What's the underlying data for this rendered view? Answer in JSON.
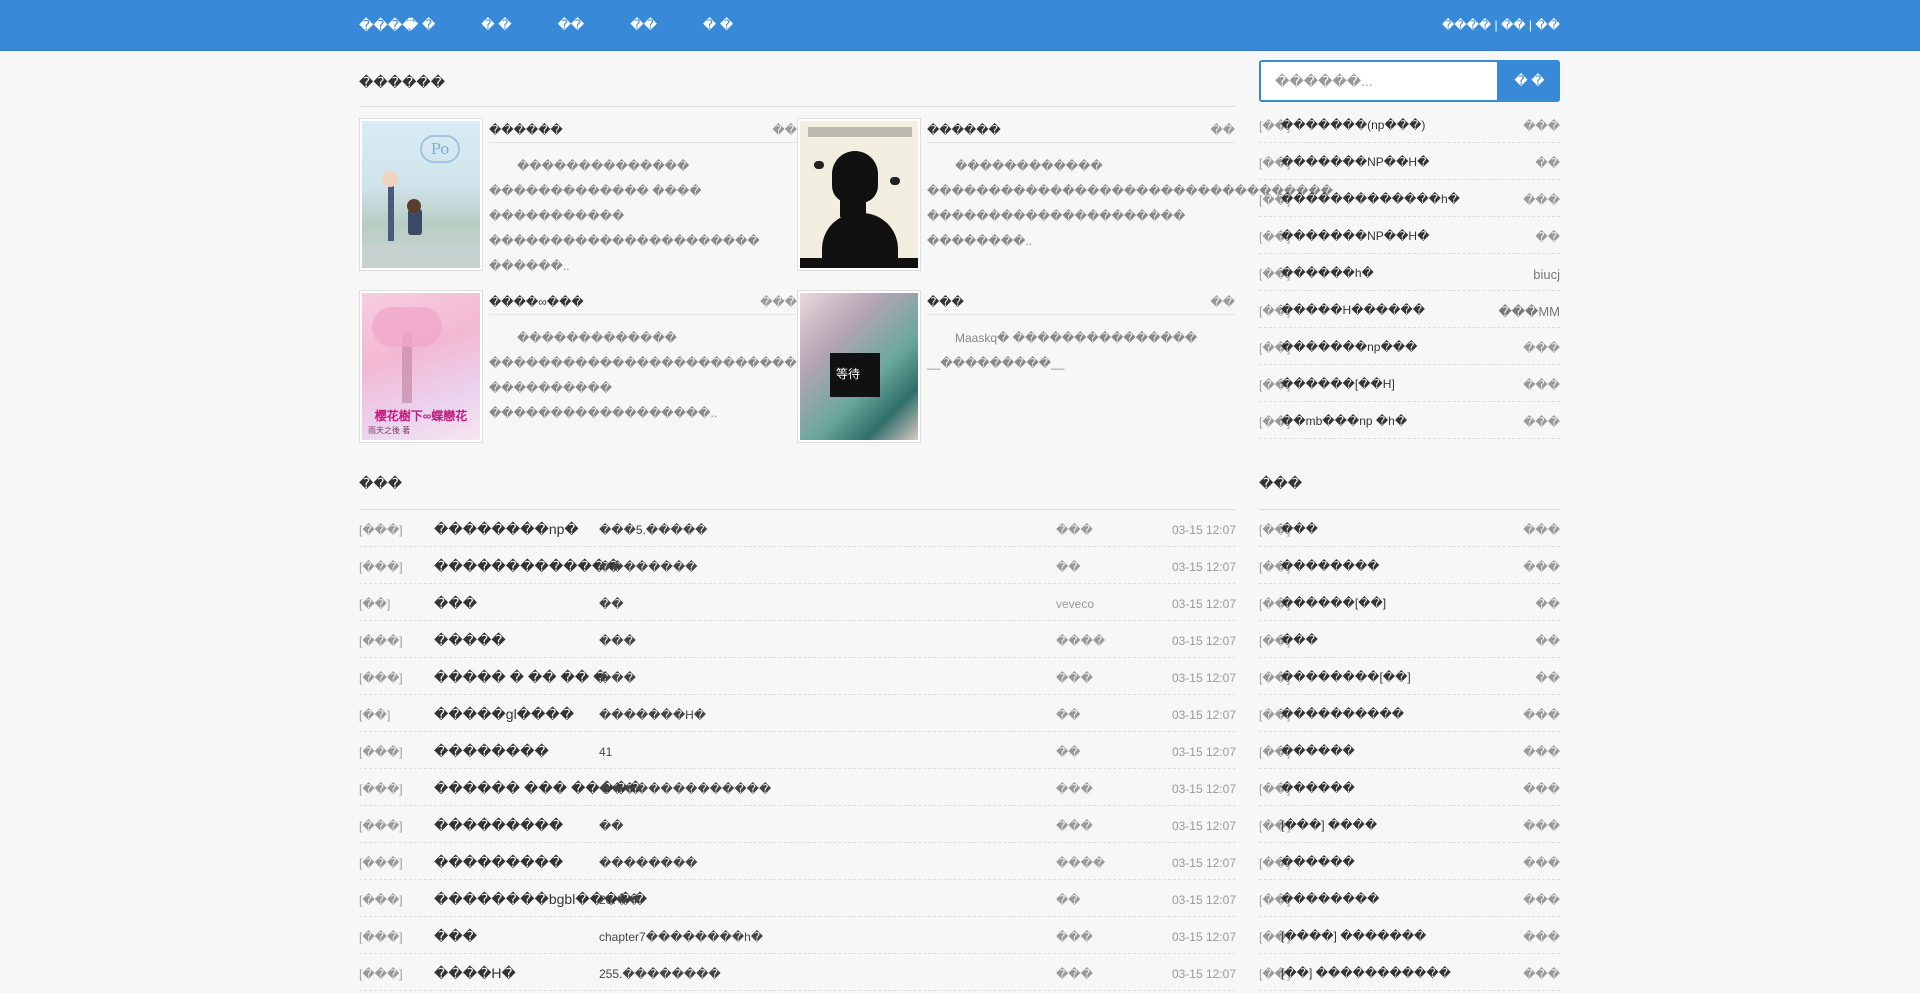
{
  "header": {
    "brand": "����",
    "nav": [
      "� �",
      "� �",
      "��",
      "��",
      "� �"
    ],
    "auth": [
      "����",
      "��",
      "��"
    ]
  },
  "recommend": {
    "title": "������",
    "books": [
      {
        "title": "������",
        "author": "��",
        "desc": "�������������� ������������� ���� ����������� ���������������������� ������.."
      },
      {
        "title": "������",
        "author": "��",
        "desc": "������������ ��������������������������������� ��������������������� ��������.."
      },
      {
        "title": "����∞���",
        "author": "���",
        "desc": "������������� �������������������������������� ���������� ������������������.."
      },
      {
        "title": "���",
        "author": "��",
        "desc": "Maaskq� ��������������� __���������__"
      }
    ]
  },
  "updates": {
    "title": "���",
    "rows": [
      {
        "cat": "[���]",
        "name": "��������np�",
        "chap": "���5.�����",
        "author": "���",
        "time": "03-15 12:07"
      },
      {
        "cat": "[���]",
        "name": "�������������",
        "chap": "��������",
        "author": "��",
        "time": "03-15 12:07"
      },
      {
        "cat": "[��]",
        "name": "���",
        "chap": "��",
        "author": "veveco",
        "time": "03-15 12:07"
      },
      {
        "cat": "[���]",
        "name": "�����",
        "chap": "���",
        "author": "����",
        "time": "03-15 12:07"
      },
      {
        "cat": "[���]",
        "name": "����� � �� �� �",
        "chap": "���",
        "author": "���",
        "time": "03-15 12:07"
      },
      {
        "cat": "[��]",
        "name": "�����gl����",
        "chap": "�������H�",
        "author": "��",
        "time": "03-15 12:07"
      },
      {
        "cat": "[���]",
        "name": "��������",
        "chap": "41",
        "author": "��",
        "time": "03-15 12:07"
      },
      {
        "cat": "[���]",
        "name": "������ ��� �����",
        "chap": "��������������",
        "author": "���",
        "time": "03-15 12:07"
      },
      {
        "cat": "[���]",
        "name": "���������",
        "chap": "��",
        "author": "���",
        "time": "03-15 12:07"
      },
      {
        "cat": "[���]",
        "name": "���������",
        "chap": "��������",
        "author": "����",
        "time": "03-15 12:07"
      },
      {
        "cat": "[���]",
        "name": "��������bgbl�����",
        "chap": "20.��",
        "author": "��",
        "time": "03-15 12:07"
      },
      {
        "cat": "[���]",
        "name": "���",
        "chap": "chapter7��������h�",
        "author": "���",
        "time": "03-15 12:07"
      },
      {
        "cat": "[���]",
        "name": "����H�",
        "chap": "255.��������",
        "author": "���",
        "time": "03-15 12:07"
      }
    ]
  },
  "search": {
    "placeholder": "������...",
    "button": "� �"
  },
  "top_list": [
    {
      "cat": "[��]",
      "name": "�������(np���)",
      "author": "���"
    },
    {
      "cat": "[��]",
      "name": "�������NP��H�",
      "author": "��"
    },
    {
      "cat": "[��]",
      "name": "�������������h�",
      "author": "���"
    },
    {
      "cat": "[��]",
      "name": "�������NP��H�",
      "author": "��"
    },
    {
      "cat": "[��]",
      "name": "������h�",
      "author": "biucj",
      "dark": true
    },
    {
      "cat": "[��]",
      "name": "�����H������",
      "author": "���MM",
      "dark": true
    },
    {
      "cat": "[��]",
      "name": "�������np���",
      "author": "���"
    },
    {
      "cat": "[��]",
      "name": "������[��H]",
      "author": "���"
    },
    {
      "cat": "[��]",
      "name": "��mb���np �h�",
      "author": "���"
    }
  ],
  "hot": {
    "title": "���",
    "rows": [
      {
        "cat": "[��]",
        "name": "���",
        "author": "���"
      },
      {
        "cat": "[��]",
        "name": "��������",
        "author": "���"
      },
      {
        "cat": "[��]",
        "name": "������[��]",
        "author": "��"
      },
      {
        "cat": "[��]",
        "name": "���",
        "author": "��"
      },
      {
        "cat": "[��]",
        "name": "��������[��]",
        "author": "��"
      },
      {
        "cat": "[��]",
        "name": "����������",
        "author": "���"
      },
      {
        "cat": "[��]",
        "name": "������",
        "author": "���"
      },
      {
        "cat": "[��]",
        "name": "������",
        "author": "���"
      },
      {
        "cat": "[��]",
        "name": "[���] ����",
        "author": "���"
      },
      {
        "cat": "[��]",
        "name": "������",
        "author": "���"
      },
      {
        "cat": "[��]",
        "name": "��������",
        "author": "���"
      },
      {
        "cat": "[��]",
        "name": "[����] �������",
        "author": "���"
      },
      {
        "cat": "[��]",
        "name": "[��] �����������",
        "author": "���"
      }
    ]
  }
}
